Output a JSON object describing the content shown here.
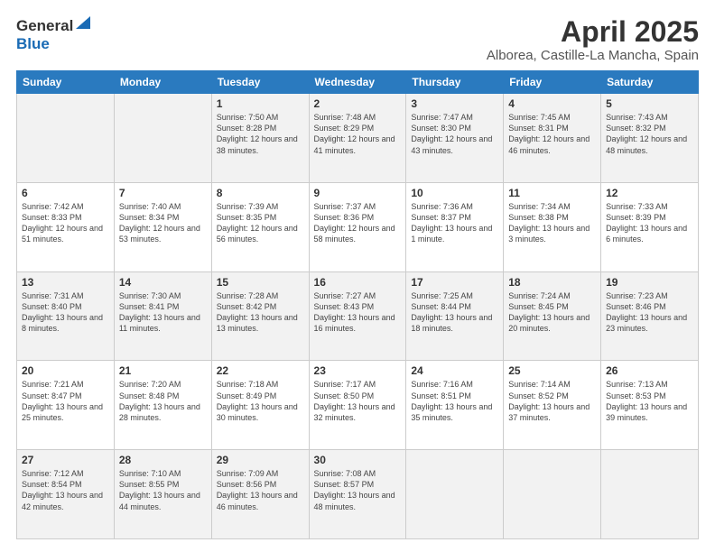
{
  "header": {
    "logo_general": "General",
    "logo_blue": "Blue",
    "title": "April 2025",
    "location": "Alborea, Castille-La Mancha, Spain"
  },
  "weekdays": [
    "Sunday",
    "Monday",
    "Tuesday",
    "Wednesday",
    "Thursday",
    "Friday",
    "Saturday"
  ],
  "weeks": [
    [
      {
        "day": "",
        "sunrise": "",
        "sunset": "",
        "daylight": ""
      },
      {
        "day": "",
        "sunrise": "",
        "sunset": "",
        "daylight": ""
      },
      {
        "day": "1",
        "sunrise": "Sunrise: 7:50 AM",
        "sunset": "Sunset: 8:28 PM",
        "daylight": "Daylight: 12 hours and 38 minutes."
      },
      {
        "day": "2",
        "sunrise": "Sunrise: 7:48 AM",
        "sunset": "Sunset: 8:29 PM",
        "daylight": "Daylight: 12 hours and 41 minutes."
      },
      {
        "day": "3",
        "sunrise": "Sunrise: 7:47 AM",
        "sunset": "Sunset: 8:30 PM",
        "daylight": "Daylight: 12 hours and 43 minutes."
      },
      {
        "day": "4",
        "sunrise": "Sunrise: 7:45 AM",
        "sunset": "Sunset: 8:31 PM",
        "daylight": "Daylight: 12 hours and 46 minutes."
      },
      {
        "day": "5",
        "sunrise": "Sunrise: 7:43 AM",
        "sunset": "Sunset: 8:32 PM",
        "daylight": "Daylight: 12 hours and 48 minutes."
      }
    ],
    [
      {
        "day": "6",
        "sunrise": "Sunrise: 7:42 AM",
        "sunset": "Sunset: 8:33 PM",
        "daylight": "Daylight: 12 hours and 51 minutes."
      },
      {
        "day": "7",
        "sunrise": "Sunrise: 7:40 AM",
        "sunset": "Sunset: 8:34 PM",
        "daylight": "Daylight: 12 hours and 53 minutes."
      },
      {
        "day": "8",
        "sunrise": "Sunrise: 7:39 AM",
        "sunset": "Sunset: 8:35 PM",
        "daylight": "Daylight: 12 hours and 56 minutes."
      },
      {
        "day": "9",
        "sunrise": "Sunrise: 7:37 AM",
        "sunset": "Sunset: 8:36 PM",
        "daylight": "Daylight: 12 hours and 58 minutes."
      },
      {
        "day": "10",
        "sunrise": "Sunrise: 7:36 AM",
        "sunset": "Sunset: 8:37 PM",
        "daylight": "Daylight: 13 hours and 1 minute."
      },
      {
        "day": "11",
        "sunrise": "Sunrise: 7:34 AM",
        "sunset": "Sunset: 8:38 PM",
        "daylight": "Daylight: 13 hours and 3 minutes."
      },
      {
        "day": "12",
        "sunrise": "Sunrise: 7:33 AM",
        "sunset": "Sunset: 8:39 PM",
        "daylight": "Daylight: 13 hours and 6 minutes."
      }
    ],
    [
      {
        "day": "13",
        "sunrise": "Sunrise: 7:31 AM",
        "sunset": "Sunset: 8:40 PM",
        "daylight": "Daylight: 13 hours and 8 minutes."
      },
      {
        "day": "14",
        "sunrise": "Sunrise: 7:30 AM",
        "sunset": "Sunset: 8:41 PM",
        "daylight": "Daylight: 13 hours and 11 minutes."
      },
      {
        "day": "15",
        "sunrise": "Sunrise: 7:28 AM",
        "sunset": "Sunset: 8:42 PM",
        "daylight": "Daylight: 13 hours and 13 minutes."
      },
      {
        "day": "16",
        "sunrise": "Sunrise: 7:27 AM",
        "sunset": "Sunset: 8:43 PM",
        "daylight": "Daylight: 13 hours and 16 minutes."
      },
      {
        "day": "17",
        "sunrise": "Sunrise: 7:25 AM",
        "sunset": "Sunset: 8:44 PM",
        "daylight": "Daylight: 13 hours and 18 minutes."
      },
      {
        "day": "18",
        "sunrise": "Sunrise: 7:24 AM",
        "sunset": "Sunset: 8:45 PM",
        "daylight": "Daylight: 13 hours and 20 minutes."
      },
      {
        "day": "19",
        "sunrise": "Sunrise: 7:23 AM",
        "sunset": "Sunset: 8:46 PM",
        "daylight": "Daylight: 13 hours and 23 minutes."
      }
    ],
    [
      {
        "day": "20",
        "sunrise": "Sunrise: 7:21 AM",
        "sunset": "Sunset: 8:47 PM",
        "daylight": "Daylight: 13 hours and 25 minutes."
      },
      {
        "day": "21",
        "sunrise": "Sunrise: 7:20 AM",
        "sunset": "Sunset: 8:48 PM",
        "daylight": "Daylight: 13 hours and 28 minutes."
      },
      {
        "day": "22",
        "sunrise": "Sunrise: 7:18 AM",
        "sunset": "Sunset: 8:49 PM",
        "daylight": "Daylight: 13 hours and 30 minutes."
      },
      {
        "day": "23",
        "sunrise": "Sunrise: 7:17 AM",
        "sunset": "Sunset: 8:50 PM",
        "daylight": "Daylight: 13 hours and 32 minutes."
      },
      {
        "day": "24",
        "sunrise": "Sunrise: 7:16 AM",
        "sunset": "Sunset: 8:51 PM",
        "daylight": "Daylight: 13 hours and 35 minutes."
      },
      {
        "day": "25",
        "sunrise": "Sunrise: 7:14 AM",
        "sunset": "Sunset: 8:52 PM",
        "daylight": "Daylight: 13 hours and 37 minutes."
      },
      {
        "day": "26",
        "sunrise": "Sunrise: 7:13 AM",
        "sunset": "Sunset: 8:53 PM",
        "daylight": "Daylight: 13 hours and 39 minutes."
      }
    ],
    [
      {
        "day": "27",
        "sunrise": "Sunrise: 7:12 AM",
        "sunset": "Sunset: 8:54 PM",
        "daylight": "Daylight: 13 hours and 42 minutes."
      },
      {
        "day": "28",
        "sunrise": "Sunrise: 7:10 AM",
        "sunset": "Sunset: 8:55 PM",
        "daylight": "Daylight: 13 hours and 44 minutes."
      },
      {
        "day": "29",
        "sunrise": "Sunrise: 7:09 AM",
        "sunset": "Sunset: 8:56 PM",
        "daylight": "Daylight: 13 hours and 46 minutes."
      },
      {
        "day": "30",
        "sunrise": "Sunrise: 7:08 AM",
        "sunset": "Sunset: 8:57 PM",
        "daylight": "Daylight: 13 hours and 48 minutes."
      },
      {
        "day": "",
        "sunrise": "",
        "sunset": "",
        "daylight": ""
      },
      {
        "day": "",
        "sunrise": "",
        "sunset": "",
        "daylight": ""
      },
      {
        "day": "",
        "sunrise": "",
        "sunset": "",
        "daylight": ""
      }
    ]
  ]
}
